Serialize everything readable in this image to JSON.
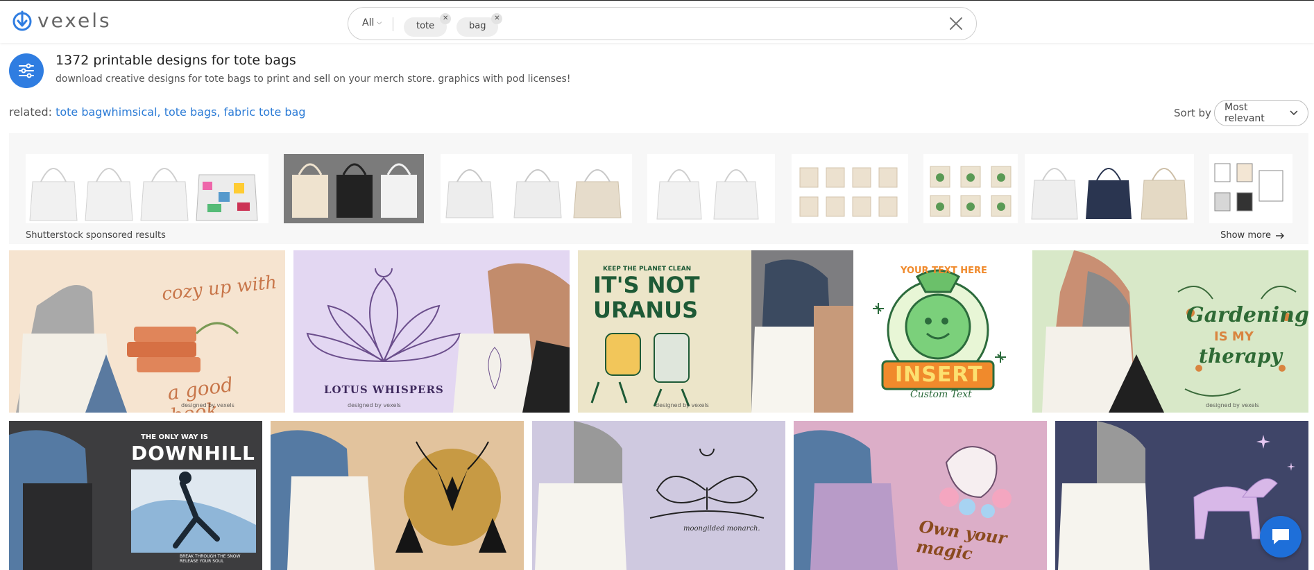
{
  "header": {
    "logo_text": "vexels",
    "search": {
      "filter_label": "All",
      "chips": [
        "tote",
        "bag"
      ],
      "clear_icon": "close-icon"
    }
  },
  "intro": {
    "title": "1372 printable designs for tote bags",
    "subtitle": "download creative designs for tote bags to print and sell on your merch store. graphics with pod licenses!"
  },
  "related": {
    "label": "related:",
    "links": [
      "tote bagwhimsical",
      "tote bags",
      "fabric tote bag"
    ]
  },
  "sort": {
    "label": "Sort by",
    "value": "Most relevant"
  },
  "sponsored": {
    "label": "Shutterstock sponsored results",
    "show_more": "Show more"
  },
  "designs": {
    "row1": [
      {
        "headline": "cozy up with",
        "tagline": "a good book",
        "bg": "#f7e3cf"
      },
      {
        "headline": "LOTUS WHISPERS",
        "bg": "#e3d7f2"
      },
      {
        "top": "KEEP THE PLANET CLEAN",
        "headline": "IT'S NOT URANUS",
        "bg": "#ece5c9"
      },
      {
        "arc": "YOUR TEXT HERE",
        "headline": "INSERT",
        "tagline": "Custom Text",
        "bg": "#ffffff"
      },
      {
        "headline": "Gardening",
        "mid": "IS MY",
        "tagline": "therapy",
        "bg": "#d8e8c8"
      }
    ],
    "row2": [
      {
        "top": "THE ONLY WAY IS",
        "headline": "DOWNHILL",
        "tagline": "BREAK THROUGH THE SNOW RELEASE YOUR SOUL",
        "bg": "#3d3d3f"
      },
      {
        "bg": "#e2c39d"
      },
      {
        "tagline": "moongilded monarch.",
        "bg": "#cfc9e0"
      },
      {
        "tagline": "Own your magic",
        "bg": "#dcaec8"
      },
      {
        "bg": "#3f4568"
      }
    ],
    "watermark": "designed by vexels"
  },
  "colors": {
    "accent": "#2f7de1",
    "link": "#2b7bd6"
  }
}
